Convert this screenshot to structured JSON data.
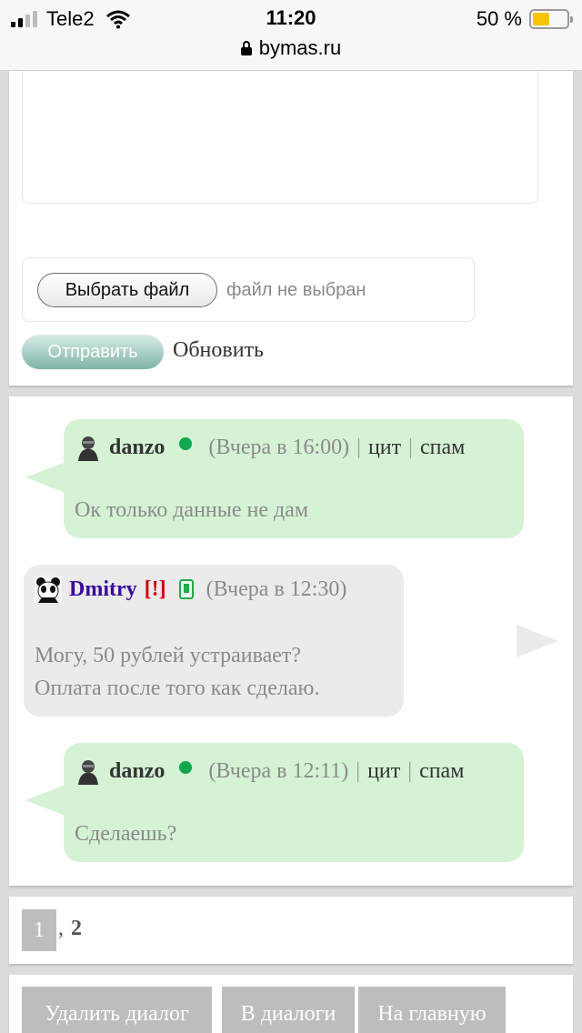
{
  "status_bar": {
    "carrier": "Tele2",
    "time": "11:20",
    "battery_text": "50 %",
    "battery_fill": 0.5,
    "url": "bymas.ru"
  },
  "form": {
    "choose_file_label": "Выбрать файл",
    "no_file_text": "файл не выбран",
    "send_label": "Отправить",
    "refresh_label": "Обновить"
  },
  "messages": [
    {
      "user": "danzo",
      "time": "(Вчера в 16:00)",
      "quote": "цит",
      "spam": "спам",
      "lines": [
        "Ок только данные не дам"
      ]
    },
    {
      "user": "Dmitry",
      "flag": "[!]",
      "time": "(Вчера в 12:30)",
      "lines": [
        "Могу, 50 рублей устраивает?",
        "Оплата после того как сделаю."
      ]
    },
    {
      "user": "danzo",
      "time": "(Вчера в 12:11)",
      "quote": "цит",
      "spam": "спам",
      "lines": [
        "Сделаешь?"
      ]
    }
  ],
  "pagination": {
    "current": "1",
    "separator": ",",
    "next": "2"
  },
  "actions": {
    "delete": "Удалить диалог",
    "dialogs": "В диалоги",
    "home": "На главную"
  },
  "colors": {
    "my_bubble": "#d5f2d5",
    "other_bubble": "#ebebeb",
    "online": "#12a84e",
    "flag": "#d00000",
    "send_button": "#7fb2a8"
  }
}
